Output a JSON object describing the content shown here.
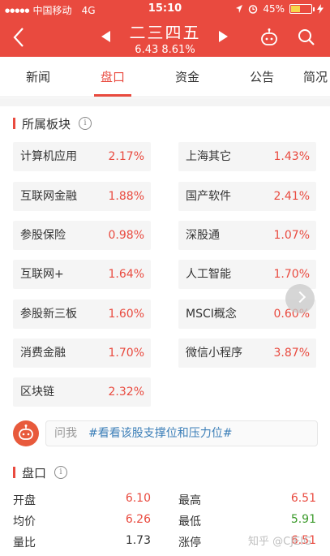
{
  "status_bar": {
    "carrier": "中国移动",
    "network": "4G",
    "time": "15:10",
    "battery_pct_text": "45%",
    "battery_level": 0.45,
    "signal_dots": "●●●●●"
  },
  "header": {
    "title": "二三四五",
    "subtitle": "6.43 8.61%",
    "bg_color": "#e94a3f"
  },
  "tabs": [
    {
      "label": "新闻"
    },
    {
      "label": "盘口",
      "active": true
    },
    {
      "label": "资金"
    },
    {
      "label": "公告"
    },
    {
      "label": "简况"
    }
  ],
  "sectors": {
    "title": "所属板块",
    "items": [
      {
        "name": "计算机应用",
        "pct": "2.17%"
      },
      {
        "name": "上海其它",
        "pct": "1.43%"
      },
      {
        "name": "互联网金融",
        "pct": "1.88%"
      },
      {
        "name": "国产软件",
        "pct": "2.41%"
      },
      {
        "name": "参股保险",
        "pct": "0.98%"
      },
      {
        "name": "深股通",
        "pct": "1.07%"
      },
      {
        "name": "互联网+",
        "pct": "1.64%"
      },
      {
        "name": "人工智能",
        "pct": "1.70%"
      },
      {
        "name": "参股新三板",
        "pct": "1.60%"
      },
      {
        "name": "MSCI概念",
        "pct": "0.60%"
      },
      {
        "name": "消费金融",
        "pct": "1.70%"
      },
      {
        "name": "微信小程序",
        "pct": "3.87%"
      },
      {
        "name": "区块链",
        "pct": "2.32%"
      }
    ]
  },
  "ask": {
    "prefix": "问我",
    "hashtag": "#看看该股支撑位和压力位#"
  },
  "quote": {
    "title": "盘口",
    "rows": [
      {
        "left_label": "开盘",
        "left_value": "6.10",
        "right_label": "最高",
        "right_value": "6.51"
      },
      {
        "left_label": "均价",
        "left_value": "6.26",
        "right_label": "最低",
        "right_value": "5.91"
      },
      {
        "left_label": "量比",
        "left_value": "1.73",
        "right_label": "涨停",
        "right_value": "6.51"
      }
    ]
  },
  "watermark": "知乎 @CJEIG"
}
